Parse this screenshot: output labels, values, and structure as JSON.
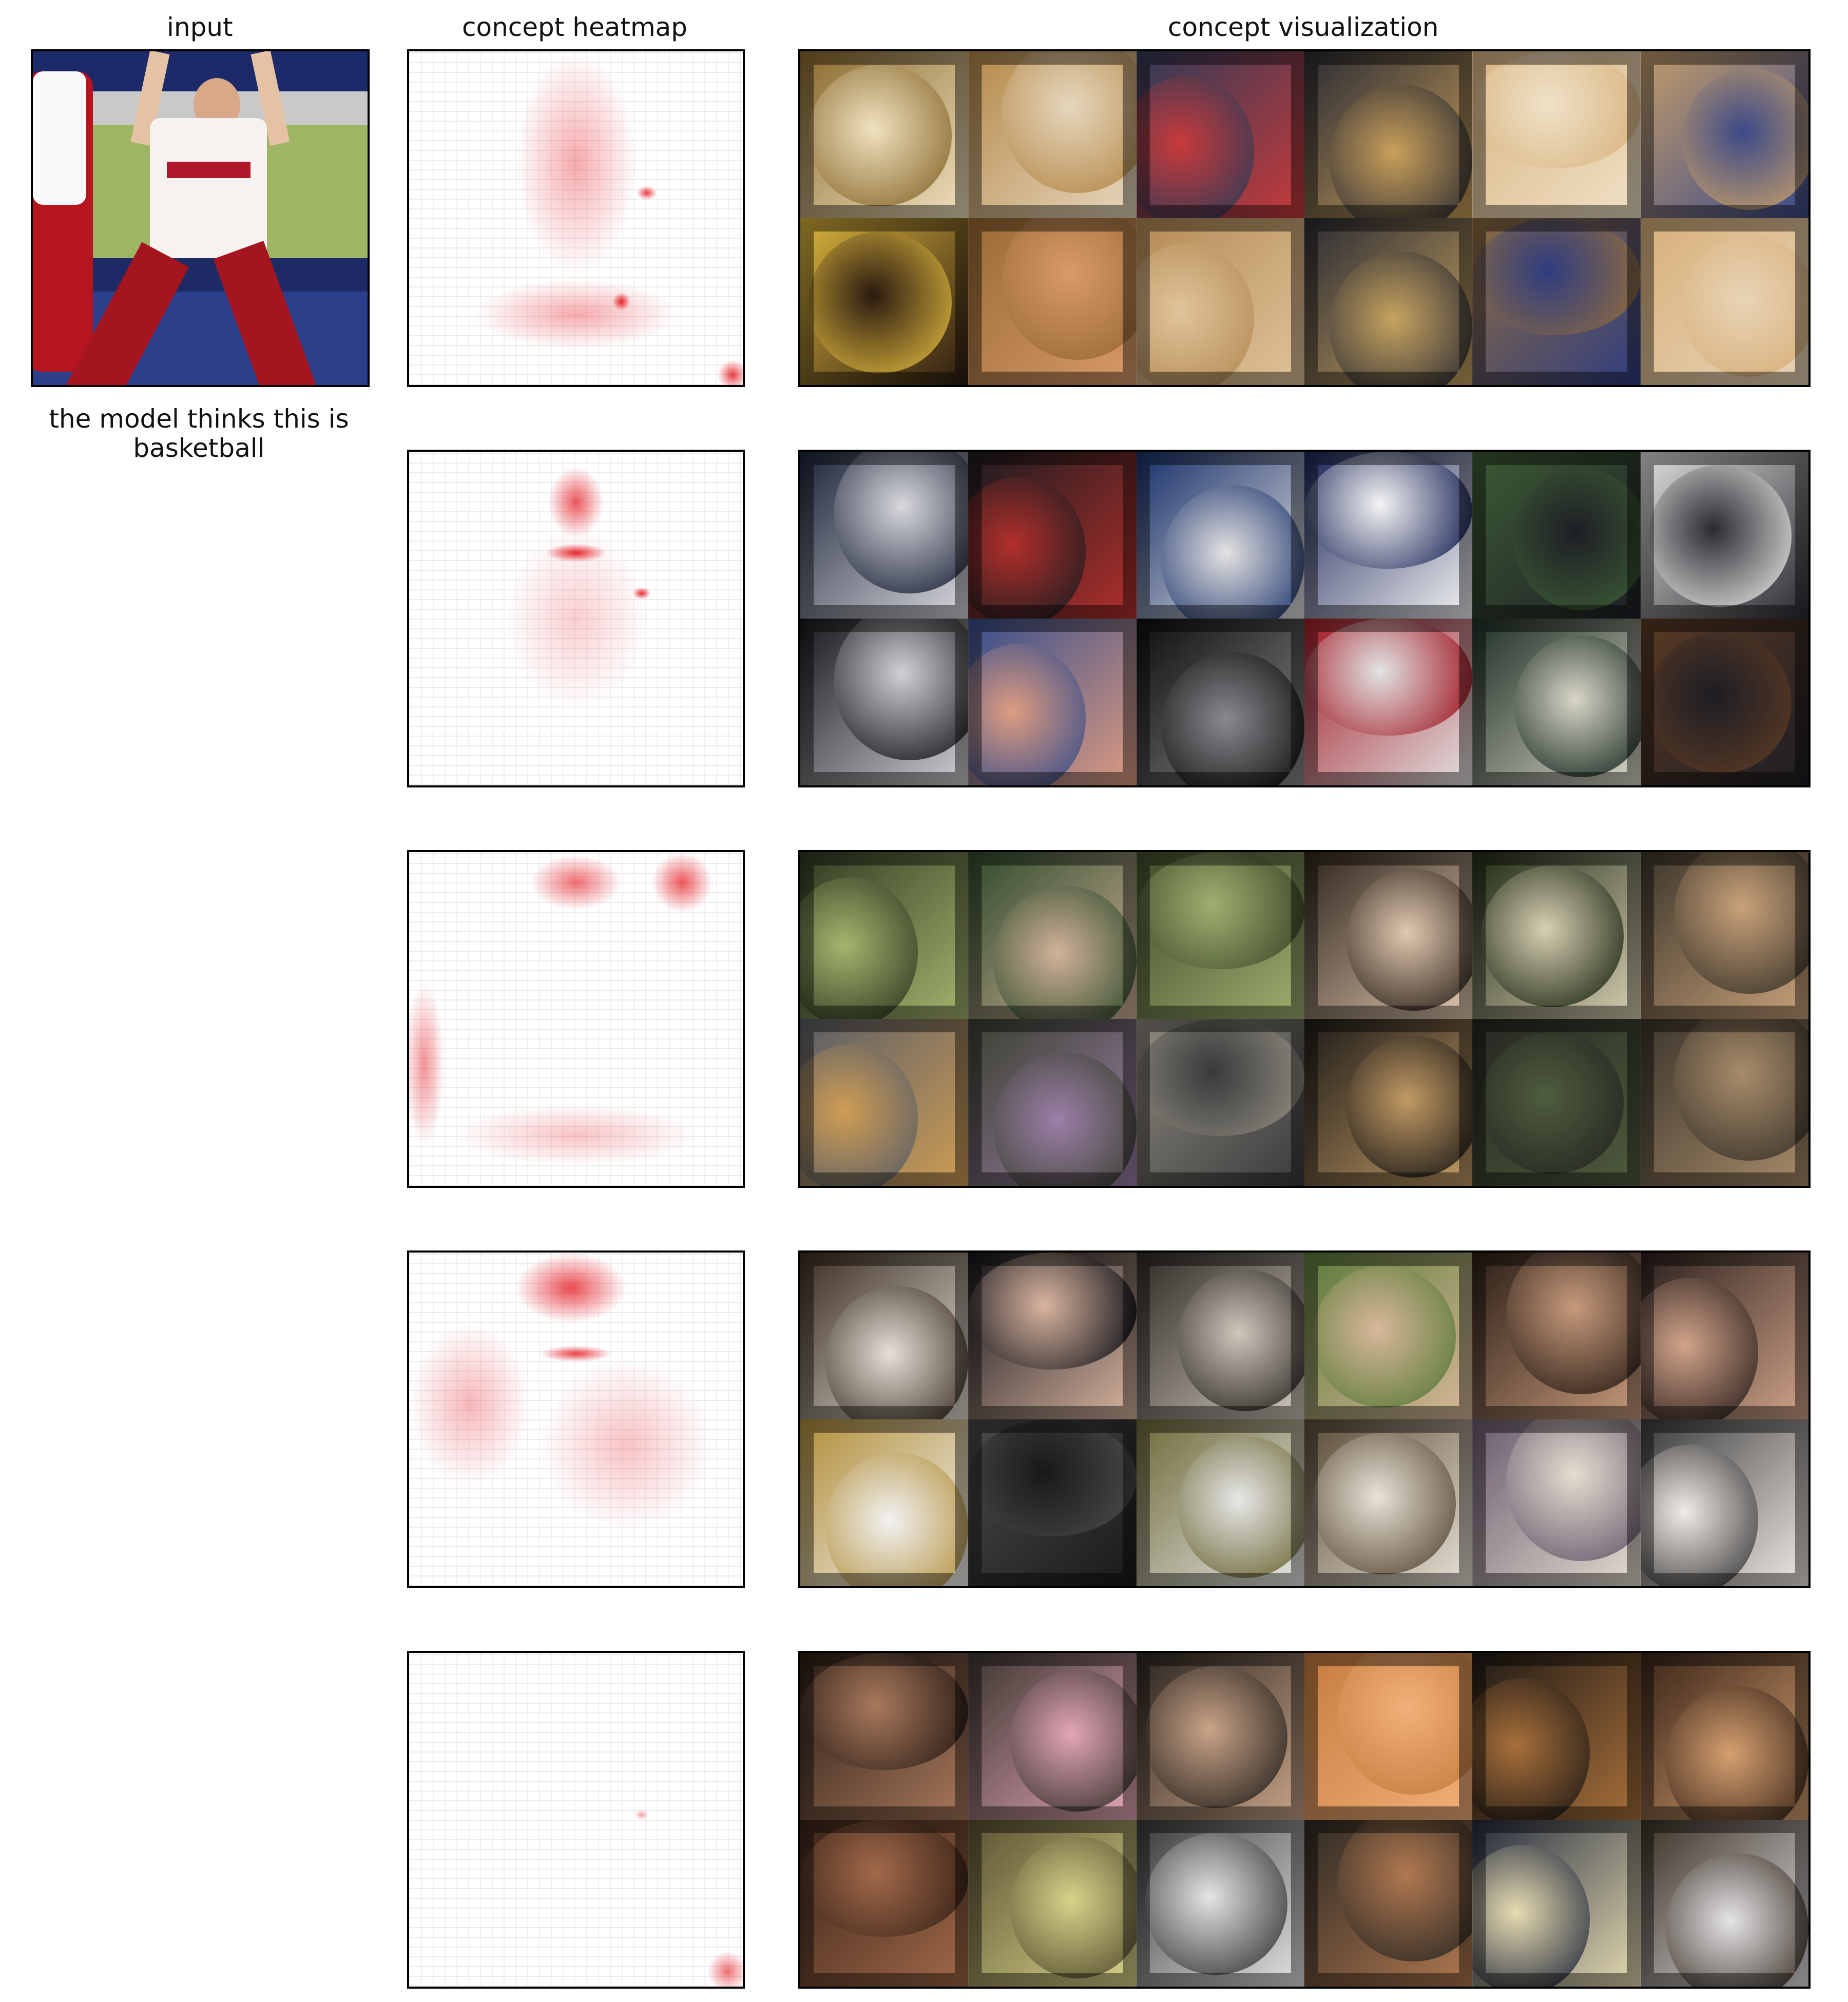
{
  "titles": {
    "input": "input",
    "heatmap": "concept heatmap",
    "visualization": "concept visualization"
  },
  "prediction": "the model thinks this is basketball",
  "concepts": [
    {
      "heat": "#e30f16",
      "tiles": [
        [
          "#8a6a2e",
          "#f0e2c0"
        ],
        [
          "#b5894a",
          "#e6d7bd"
        ],
        [
          "#2f3a57",
          "#c83a3a"
        ],
        [
          "#2a2b33",
          "#caa05a"
        ],
        [
          "#d9b581",
          "#efe1c7"
        ],
        [
          "#c29c6a",
          "#3c4a88"
        ],
        [
          "#d9b33c",
          "#2a1a10"
        ],
        [
          "#9a6a34",
          "#d89a68"
        ],
        [
          "#b48a55",
          "#e0c49a"
        ],
        [
          "#2b2b33",
          "#c7a460"
        ],
        [
          "#8e6b3f",
          "#2f3d80"
        ],
        [
          "#d8b07b",
          "#e8d4b6"
        ]
      ]
    },
    {
      "heat": "#e30f16",
      "tiles": [
        [
          "#1c2439",
          "#d9d9de"
        ],
        [
          "#1b1b20",
          "#b2302b"
        ],
        [
          "#17306a",
          "#e5e3e2"
        ],
        [
          "#1a2557",
          "#f4f4f4"
        ],
        [
          "#3c5a34",
          "#1e1f26"
        ],
        [
          "#dfdfdf",
          "#2a2a30"
        ],
        [
          "#18181c",
          "#cfcfd4"
        ],
        [
          "#364d8b",
          "#de9c80"
        ],
        [
          "#0d0d0f",
          "#8a8a8e"
        ],
        [
          "#a01a25",
          "#e3e3e3"
        ],
        [
          "#1d2e24",
          "#d8d6c8"
        ],
        [
          "#5a3a24",
          "#1d1d24"
        ]
      ]
    },
    {
      "heat": "#e30f16",
      "tiles": [
        [
          "#2f3a22",
          "#a5b56e"
        ],
        [
          "#2e4a2a",
          "#d1b29a"
        ],
        [
          "#3e4a2a",
          "#9fb070"
        ],
        [
          "#2e241c",
          "#e1c9b0"
        ],
        [
          "#1f2a14",
          "#d8d0b4"
        ],
        [
          "#3b352a",
          "#c9a27a"
        ],
        [
          "#5a5e66",
          "#cf9d54"
        ],
        [
          "#3a4030",
          "#9c7fa8"
        ],
        [
          "#8e8a7e",
          "#3a3a3c"
        ],
        [
          "#1d1b18",
          "#c29a64"
        ],
        [
          "#252621",
          "#4f5d3e"
        ],
        [
          "#3c352c",
          "#a88c6a"
        ]
      ]
    },
    {
      "heat": "#e30f16",
      "tiles": [
        [
          "#3b2d24",
          "#e6e0d6"
        ],
        [
          "#14141a",
          "#d9b5a0"
        ],
        [
          "#2e2a24",
          "#cfc7bc"
        ],
        [
          "#5b7a3a",
          "#d8b89a"
        ],
        [
          "#2b1e16",
          "#c79a7c"
        ],
        [
          "#2a1f1c",
          "#d2a48a"
        ],
        [
          "#b28f3a",
          "#f2f2f2"
        ],
        [
          "#4a4a4a",
          "#191919"
        ],
        [
          "#6e6a38",
          "#e7e7e7"
        ],
        [
          "#5a4a36",
          "#e9e3d8"
        ],
        [
          "#6a5a6e",
          "#e6ddd0"
        ],
        [
          "#3a3a3a",
          "#f1ebe6"
        ]
      ]
    },
    {
      "heat": "#e30f16",
      "tiles": [
        [
          "#2b1d16",
          "#a9795c"
        ],
        [
          "#3d3630",
          "#e3a6b6"
        ],
        [
          "#2b2520",
          "#c9a488"
        ],
        [
          "#c77c3e",
          "#f1b07a"
        ],
        [
          "#201a16",
          "#a8703a"
        ],
        [
          "#3a2418",
          "#d5a070"
        ],
        [
          "#3a2418",
          "#a2694a"
        ],
        [
          "#5a5232",
          "#d8d48a"
        ],
        [
          "#373839",
          "#e5e6e3"
        ],
        [
          "#2e2a24",
          "#b07850"
        ],
        [
          "#232a3c",
          "#e7dcb2"
        ],
        [
          "#3a3024",
          "#e6e4e8"
        ]
      ]
    }
  ]
}
